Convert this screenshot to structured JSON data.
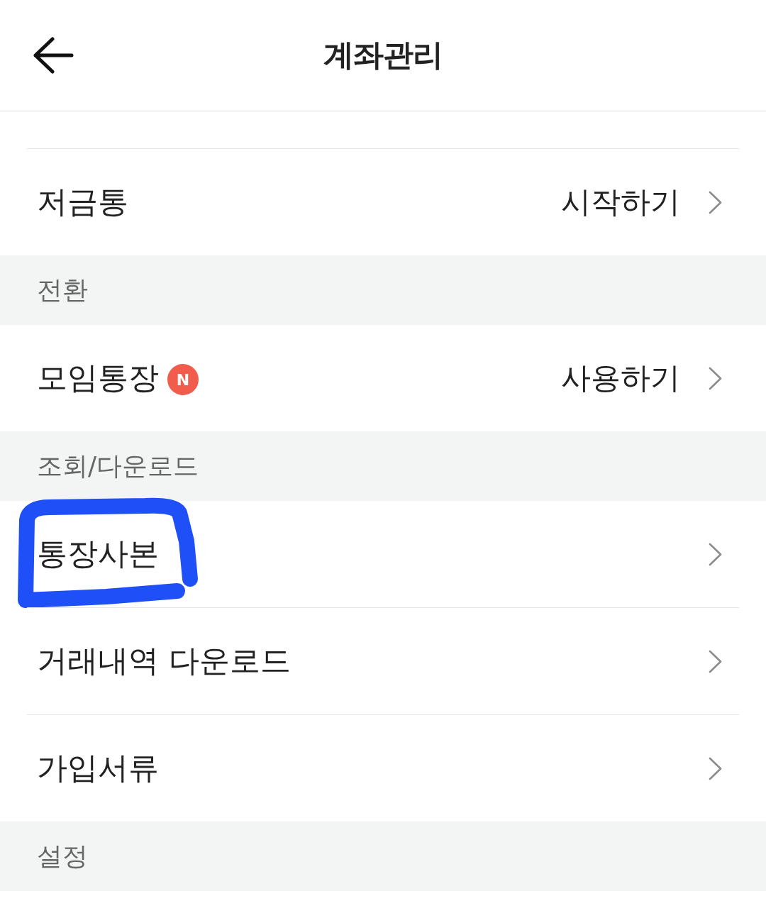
{
  "header": {
    "title": "계좌관리"
  },
  "groups": [
    {
      "items": [
        {
          "label": "저금통",
          "action": "시작하기",
          "marked": false
        }
      ]
    },
    {
      "title": "전환",
      "items": [
        {
          "label": "모임통장",
          "badge": "N",
          "action": "사용하기",
          "marked": false
        }
      ]
    },
    {
      "title": "조회/다운로드",
      "items": [
        {
          "label": "통장사본",
          "marked": true
        },
        {
          "label": "거래내역 다운로드",
          "marked": false
        },
        {
          "label": "가입서류",
          "marked": false
        }
      ]
    },
    {
      "title": "설정"
    }
  ]
}
